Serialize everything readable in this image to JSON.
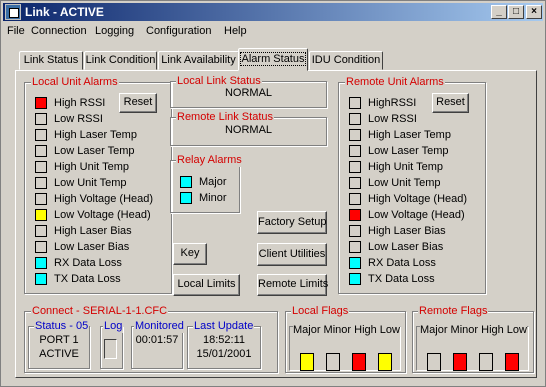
{
  "window": {
    "title": "Link - ACTIVE"
  },
  "menu": [
    "File",
    "Connection",
    "Logging",
    "Configuration",
    "Help"
  ],
  "tabs": [
    "Link Status",
    "Link Condition",
    "Link Availability",
    "Alarm Status",
    "IDU Condition"
  ],
  "active_tab": "Alarm Status",
  "colors": {
    "red": "#ff0000",
    "yellow": "#ffff00",
    "cyan": "#00ffff",
    "off": "#d4d0c8",
    "legend_red": "#d40000",
    "legend_blue": "#0000c8"
  },
  "local_unit_alarms": {
    "title": "Local Unit Alarms",
    "reset_label": "Reset",
    "items": [
      {
        "label": "High RSSI",
        "state": "red"
      },
      {
        "label": "Low RSSI",
        "state": "off"
      },
      {
        "label": "High Laser Temp",
        "state": "off"
      },
      {
        "label": "Low Laser Temp",
        "state": "off"
      },
      {
        "label": "High Unit Temp",
        "state": "off"
      },
      {
        "label": "Low Unit Temp",
        "state": "off"
      },
      {
        "label": "High Voltage (Head)",
        "state": "off"
      },
      {
        "label": "Low Voltage (Head)",
        "state": "yellow"
      },
      {
        "label": "High Laser Bias",
        "state": "off"
      },
      {
        "label": "Low Laser Bias",
        "state": "off"
      },
      {
        "label": "RX Data Loss",
        "state": "cyan"
      },
      {
        "label": "TX Data Loss",
        "state": "cyan"
      }
    ]
  },
  "local_link_status": {
    "title": "Local Link Status",
    "value": "NORMAL"
  },
  "remote_link_status": {
    "title": "Remote Link Status",
    "value": "NORMAL"
  },
  "relay_alarms": {
    "title": "Relay Alarms",
    "items": [
      {
        "label": "Major",
        "state": "cyan"
      },
      {
        "label": "Minor",
        "state": "cyan"
      }
    ]
  },
  "buttons": {
    "factory_setup": "Factory Setup",
    "key": "Key",
    "client_utilities": "Client Utilities",
    "local_limits": "Local Limits",
    "remote_limits": "Remote Limits"
  },
  "remote_unit_alarms": {
    "title": "Remote Unit Alarms",
    "reset_label": "Reset",
    "items": [
      {
        "label": "HighRSSI",
        "state": "off"
      },
      {
        "label": "Low RSSI",
        "state": "off"
      },
      {
        "label": "High Laser Temp",
        "state": "off"
      },
      {
        "label": "Low Laser Temp",
        "state": "off"
      },
      {
        "label": "High Unit Temp",
        "state": "off"
      },
      {
        "label": "Low Unit Temp",
        "state": "off"
      },
      {
        "label": "High Voltage (Head)",
        "state": "off"
      },
      {
        "label": "Low Voltage (Head)",
        "state": "red"
      },
      {
        "label": "High Laser Bias",
        "state": "off"
      },
      {
        "label": "Low Laser Bias",
        "state": "off"
      },
      {
        "label": "RX Data Loss",
        "state": "cyan"
      },
      {
        "label": "TX Data Loss",
        "state": "cyan"
      }
    ]
  },
  "connect": {
    "title": "Connect - SERIAL-1-1.CFC",
    "status": {
      "title": "Status - 05",
      "line1": "PORT 1",
      "line2": "ACTIVE"
    },
    "log": {
      "title": "Log"
    },
    "monitored": {
      "title": "Monitored",
      "value": "00:01:57"
    },
    "last_update": {
      "title": "Last Update",
      "time": "18:52:11",
      "date": "15/01/2001"
    }
  },
  "local_flags": {
    "title": "Local Flags",
    "header": "Major Minor High Low",
    "states": [
      "yellow",
      "off",
      "red",
      "yellow"
    ]
  },
  "remote_flags": {
    "title": "Remote Flags",
    "header": "Major Minor High Low",
    "states": [
      "off",
      "red",
      "off",
      "red"
    ]
  }
}
